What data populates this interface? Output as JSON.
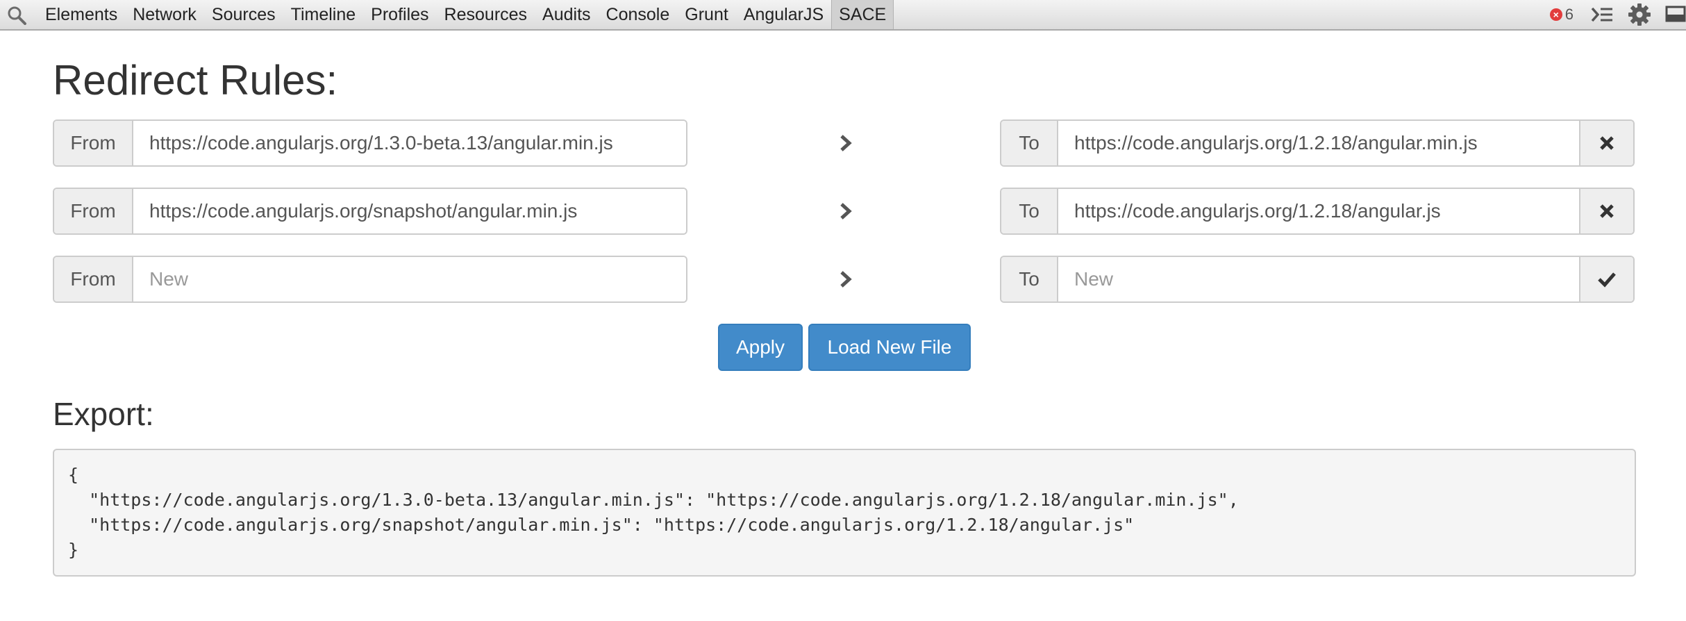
{
  "devtools": {
    "tabs": [
      {
        "label": "Elements"
      },
      {
        "label": "Network"
      },
      {
        "label": "Sources"
      },
      {
        "label": "Timeline"
      },
      {
        "label": "Profiles"
      },
      {
        "label": "Resources"
      },
      {
        "label": "Audits"
      },
      {
        "label": "Console"
      },
      {
        "label": "Grunt"
      },
      {
        "label": "AngularJS"
      },
      {
        "label": "SACE"
      }
    ],
    "active_tab": "SACE",
    "error_count": "6",
    "icons": [
      "search-icon",
      "console-drawer-icon",
      "gear-icon",
      "dock-icon"
    ]
  },
  "rules_heading": "Redirect Rules:",
  "from_label": "From",
  "to_label": "To",
  "rules": [
    {
      "from": "https://code.angularjs.org/1.3.0-beta.13/angular.min.js",
      "to": "https://code.angularjs.org/1.2.18/angular.min.js",
      "action_icon": "remove-icon"
    },
    {
      "from": "https://code.angularjs.org/snapshot/angular.min.js",
      "to": "https://code.angularjs.org/1.2.18/angular.js",
      "action_icon": "remove-icon"
    }
  ],
  "new_rule": {
    "from_placeholder": "New",
    "to_placeholder": "New",
    "action_icon": "check-icon"
  },
  "buttons": {
    "apply": "Apply",
    "load": "Load New File"
  },
  "export_heading": "Export:",
  "export_text": "{\n  \"https://code.angularjs.org/1.3.0-beta.13/angular.min.js\": \"https://code.angularjs.org/1.2.18/angular.min.js\",\n  \"https://code.angularjs.org/snapshot/angular.min.js\": \"https://code.angularjs.org/1.2.18/angular.js\"\n}",
  "colors": {
    "primary": "#428bca",
    "error": "#e23c3c",
    "addon_bg": "#eeeeee"
  }
}
